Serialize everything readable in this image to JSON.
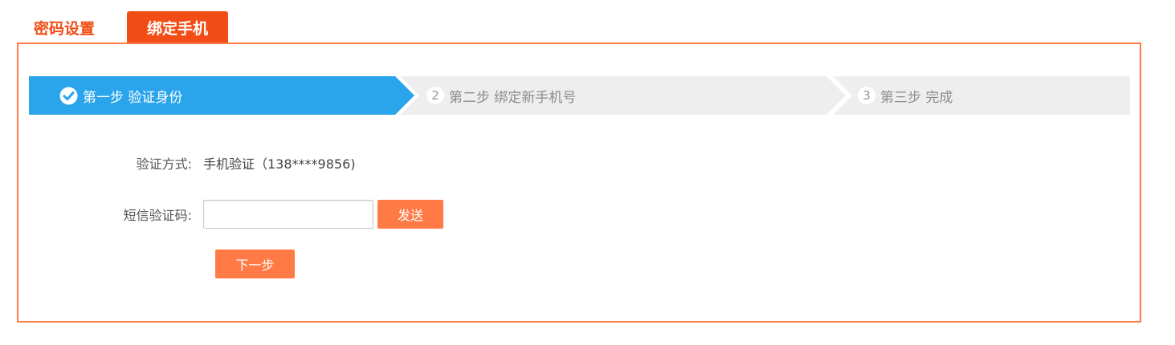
{
  "tabs": [
    {
      "label": "密码设置",
      "active": false
    },
    {
      "label": "绑定手机",
      "active": true
    }
  ],
  "steps": [
    {
      "number": "",
      "label": "第一步 验证身份",
      "state": "active",
      "icon": "check-circle-icon"
    },
    {
      "number": "2",
      "label": "第二步 绑定新手机号",
      "state": "pending"
    },
    {
      "number": "3",
      "label": "第三步 完成",
      "state": "pending"
    }
  ],
  "form": {
    "verify_method_label": "验证方式:",
    "verify_method_value": "手机验证（138****9856)",
    "sms_code_label": "短信验证码:",
    "sms_code_value": "",
    "sms_code_placeholder": "",
    "send_label": "发送",
    "next_label": "下一步"
  },
  "colors": {
    "tab_accent": "#f24d16",
    "panel_border": "#ff7a45",
    "step_active": "#2aa5ec",
    "step_inactive": "#eeeeee",
    "button": "#ff7a45"
  }
}
